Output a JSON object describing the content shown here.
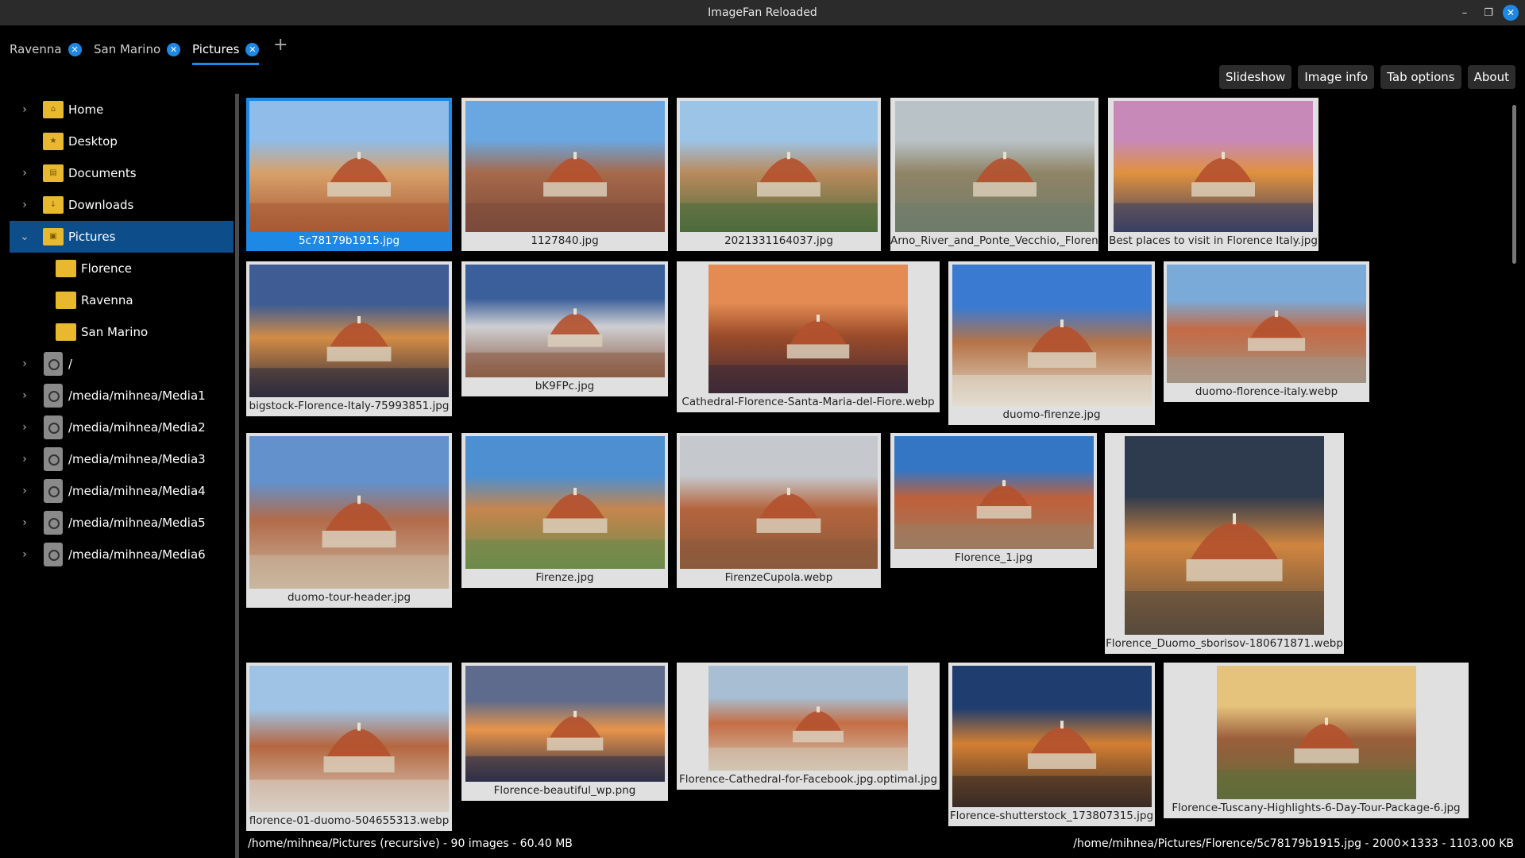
{
  "window": {
    "title": "ImageFan Reloaded"
  },
  "tabs": [
    {
      "label": "Ravenna"
    },
    {
      "label": "San Marino"
    },
    {
      "label": "Pictures"
    }
  ],
  "toolbar": {
    "slideshow": "Slideshow",
    "image_info": "Image info",
    "tab_options": "Tab options",
    "about": "About"
  },
  "sidebar": {
    "items": [
      {
        "label": "Home",
        "icon": "home-icon"
      },
      {
        "label": "Desktop",
        "icon": "star-icon"
      },
      {
        "label": "Documents",
        "icon": "document-icon"
      },
      {
        "label": "Downloads",
        "icon": "download-icon"
      },
      {
        "label": "Pictures",
        "icon": "picture-icon",
        "selected": true
      },
      {
        "label": "Florence"
      },
      {
        "label": "Ravenna"
      },
      {
        "label": "San Marino"
      },
      {
        "label": "/"
      },
      {
        "label": "/media/mihnea/Media1"
      },
      {
        "label": "/media/mihnea/Media2"
      },
      {
        "label": "/media/mihnea/Media3"
      },
      {
        "label": "/media/mihnea/Media4"
      },
      {
        "label": "/media/mihnea/Media5"
      },
      {
        "label": "/media/mihnea/Media6"
      }
    ]
  },
  "thumbnails": [
    {
      "name": "5c78179b1915.jpg",
      "selected": true
    },
    {
      "name": "1127840.jpg"
    },
    {
      "name": "2021331164037.jpg"
    },
    {
      "name": "Arno_River_and_Ponte_Vecchio,_Florence.jpg"
    },
    {
      "name": "Best places to visit in Florence Italy.jpg"
    },
    {
      "name": "bigstock-Florence-Italy-75993851.jpg"
    },
    {
      "name": "bK9FPc.jpg"
    },
    {
      "name": "Cathedral-Florence-Santa-Maria-del-Fiore.webp"
    },
    {
      "name": "duomo-firenze.jpg"
    },
    {
      "name": "duomo-florence-italy.webp"
    },
    {
      "name": "duomo-tour-header.jpg"
    },
    {
      "name": "Firenze.jpg"
    },
    {
      "name": "FirenzeCupola.webp"
    },
    {
      "name": "Florence_1.jpg"
    },
    {
      "name": "Florence_Duomo_sborisov-180671871.webp"
    },
    {
      "name": "florence-01-duomo-504655313.webp"
    },
    {
      "name": "Florence-beautiful_wp.png"
    },
    {
      "name": "Florence-Cathedral-for-Facebook.jpg.optimal.jpg"
    },
    {
      "name": "Florence-shutterstock_173807315.jpg"
    },
    {
      "name": "Florence-Tuscany-Highlights-6-Day-Tour-Package-6.jpg"
    }
  ],
  "status": {
    "left": "/home/mihnea/Pictures (recursive) - 90 images - 60.40 MB",
    "right": "/home/mihnea/Pictures/Florence/5c78179b1915.jpg - 2000×1333 - 1103.00 KB"
  }
}
